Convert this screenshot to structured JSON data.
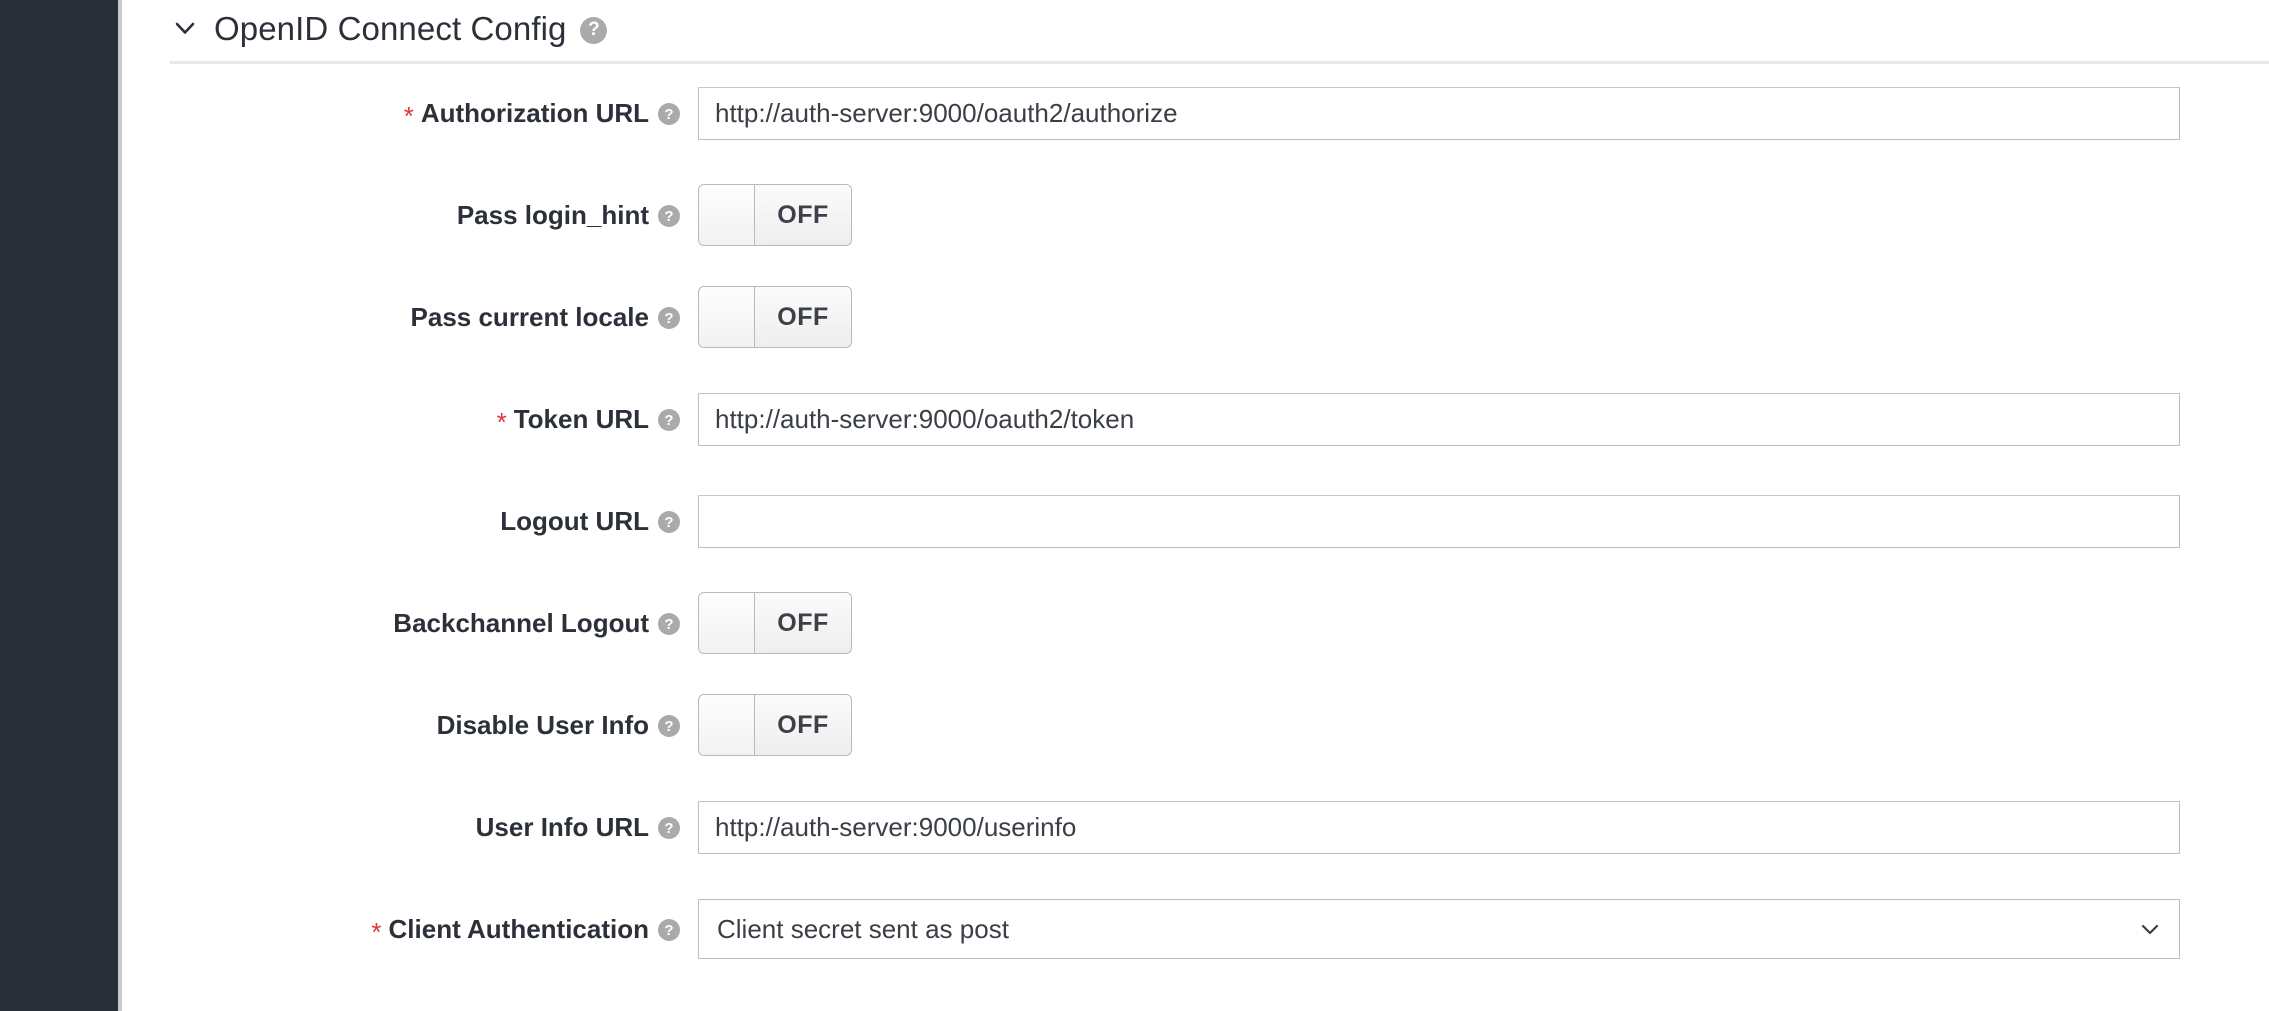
{
  "section": {
    "title": "OpenID Connect Config",
    "expanded": true,
    "collapse_icon": "chevron-down-icon",
    "help_icon": "help-circle-icon",
    "help_glyph": "?"
  },
  "colors": {
    "rail": "#282d37",
    "required_asterisk": "#d9363e",
    "label_text": "#2c3039",
    "input_border": "#bcbcbc",
    "divider": "#e7e7e7",
    "help_icon_bg": "#aaaaaa"
  },
  "form": {
    "required_marker": "*",
    "rows": [
      {
        "label": "Authorization URL",
        "required": true,
        "type": "text",
        "value": "http://auth-server:9000/oauth2/authorize",
        "placeholder": ""
      },
      {
        "label": "Pass login_hint",
        "required": false,
        "type": "toggle",
        "value": "OFF"
      },
      {
        "label": "Pass current locale",
        "required": false,
        "type": "toggle",
        "value": "OFF"
      },
      {
        "label": "Token URL",
        "required": true,
        "type": "text",
        "value": "http://auth-server:9000/oauth2/token",
        "placeholder": ""
      },
      {
        "label": "Logout URL",
        "required": false,
        "type": "text",
        "value": "",
        "placeholder": ""
      },
      {
        "label": "Backchannel Logout",
        "required": false,
        "type": "toggle",
        "value": "OFF"
      },
      {
        "label": "Disable User Info",
        "required": false,
        "type": "toggle",
        "value": "OFF"
      },
      {
        "label": "User Info URL",
        "required": false,
        "type": "text",
        "value": "http://auth-server:9000/userinfo",
        "placeholder": ""
      },
      {
        "label": "Client Authentication",
        "required": true,
        "type": "select",
        "value": "Client secret sent as post"
      }
    ]
  }
}
